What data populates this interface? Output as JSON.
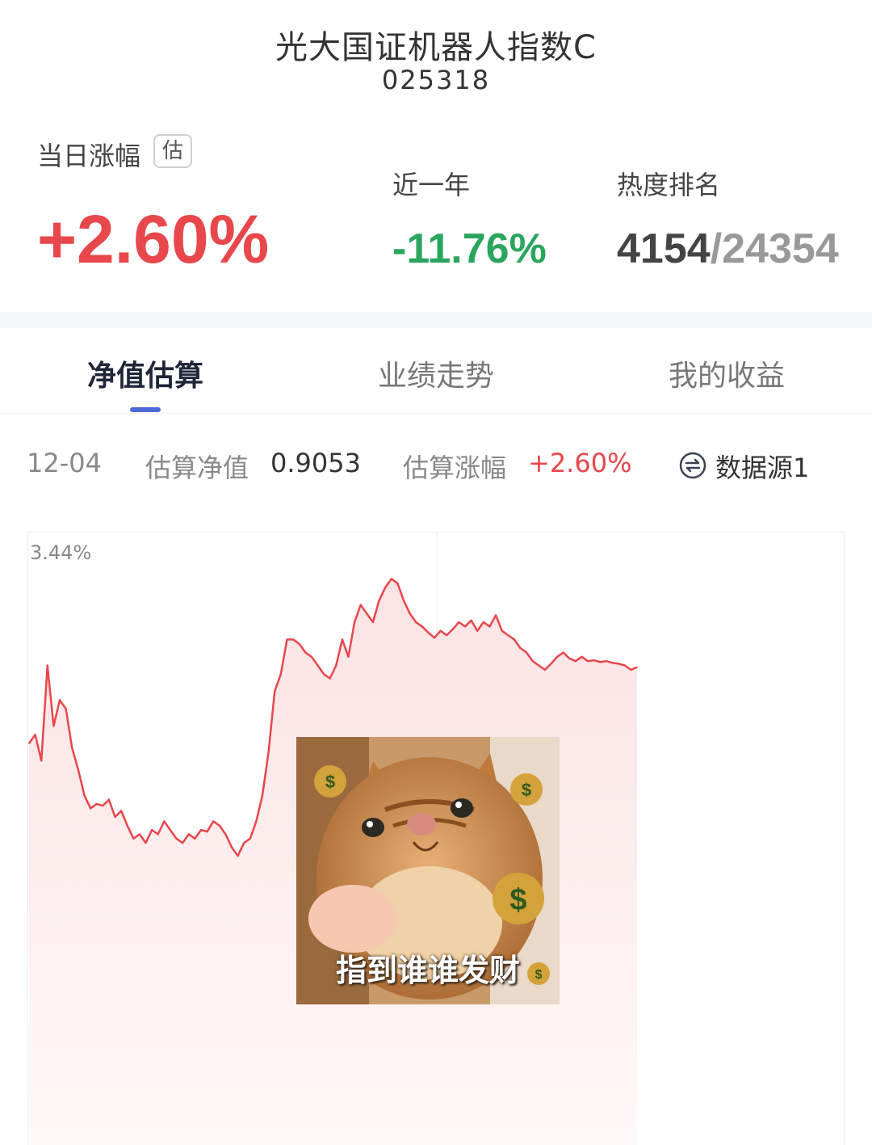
{
  "header": {
    "fund_name": "光大国证机器人指数C",
    "fund_code": "025318"
  },
  "stats": {
    "day_change_label": "当日涨幅",
    "estimate_badge": "估",
    "day_change_value": "+2.60%",
    "year_change_label": "近一年",
    "year_change_value": "-11.76%",
    "rank_label": "热度排名",
    "rank_value": "4154",
    "rank_total": "/24354"
  },
  "tabs": [
    {
      "label": "净值估算",
      "active": true
    },
    {
      "label": "业绩走势",
      "active": false
    },
    {
      "label": "我的收益",
      "active": false
    }
  ],
  "info": {
    "date": "12-04",
    "nav_label": "估算净值",
    "nav_value": "0.9053",
    "change_label": "估算涨幅",
    "change_value": "+2.60%",
    "source_icon": "refresh-icon",
    "source_label": "数据源1"
  },
  "colors": {
    "up": "#e8474b",
    "down": "#2aa55e",
    "accent": "#4b6ad8"
  },
  "meme": {
    "caption": "指到谁谁发财",
    "icons": [
      "money-bag-icon",
      "pointing-hand-icon",
      "cat-image"
    ]
  },
  "chart_data": {
    "type": "area",
    "title": "",
    "ymax_label": "3.44%",
    "ylim": [
      -3.44,
      3.44
    ],
    "grid": true,
    "y": [
      1.2,
      1.3,
      1.0,
      2.1,
      1.4,
      1.7,
      1.6,
      1.15,
      0.9,
      0.6,
      0.45,
      0.5,
      0.48,
      0.55,
      0.35,
      0.42,
      0.25,
      0.1,
      0.15,
      0.05,
      0.2,
      0.15,
      0.3,
      0.2,
      0.1,
      0.05,
      0.15,
      0.1,
      0.2,
      0.18,
      0.3,
      0.25,
      0.15,
      0.0,
      -0.1,
      0.05,
      0.1,
      0.3,
      0.6,
      1.1,
      1.8,
      2.0,
      2.4,
      2.4,
      2.35,
      2.25,
      2.2,
      2.1,
      2.0,
      1.95,
      2.1,
      2.4,
      2.2,
      2.6,
      2.8,
      2.7,
      2.6,
      2.85,
      3.0,
      3.1,
      3.05,
      2.85,
      2.7,
      2.6,
      2.55,
      2.48,
      2.42,
      2.5,
      2.45,
      2.52,
      2.6,
      2.55,
      2.62,
      2.5,
      2.6,
      2.55,
      2.68,
      2.5,
      2.45,
      2.4,
      2.3,
      2.25,
      2.15,
      2.1,
      2.05,
      2.12,
      2.2,
      2.25,
      2.18,
      2.15,
      2.2,
      2.15,
      2.16,
      2.14,
      2.15,
      2.13,
      2.12,
      2.1,
      2.05,
      2.08
    ]
  }
}
